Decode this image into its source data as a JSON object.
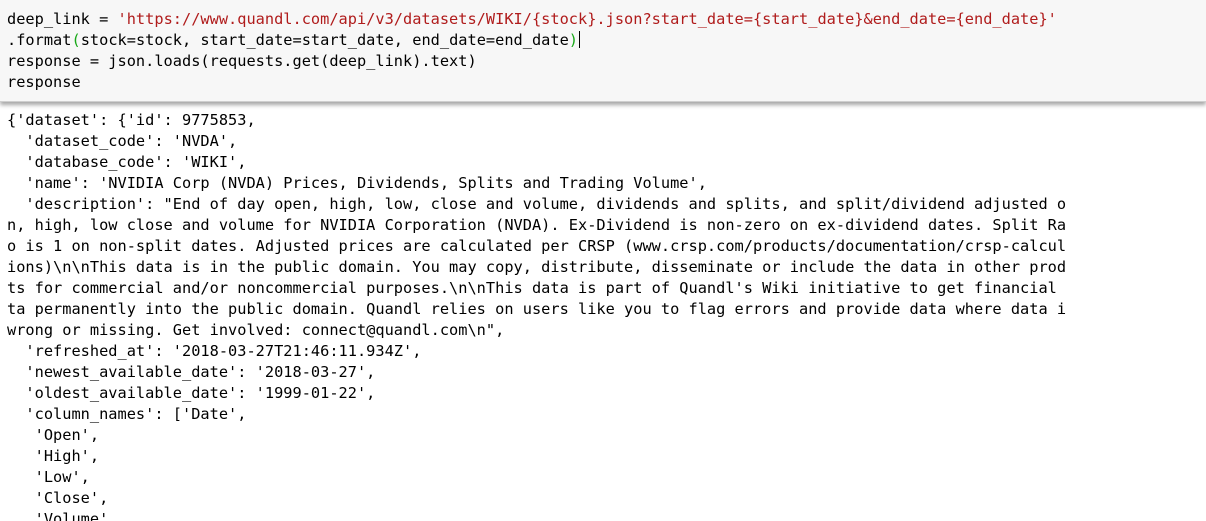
{
  "input_cell": {
    "line1": {
      "var": "deep_link = ",
      "string": "'https://www.quandl.com/api/v3/datasets/WIKI/{stock}.json?start_date={start_date}&end_date={end_date}'"
    },
    "line2": {
      "method": ".format",
      "open_paren": "(",
      "args": "stock=stock, start_date=start_date, end_date=end_date",
      "close_paren": ")"
    },
    "line3": "response = json.loads(requests.get(deep_link).text)",
    "line4": "response"
  },
  "output_lines": [
    "{'dataset': {'id': 9775853,",
    "  'dataset_code': 'NVDA',",
    "  'database_code': 'WIKI',",
    "  'name': 'NVIDIA Corp (NVDA) Prices, Dividends, Splits and Trading Volume',",
    "  'description': \"End of day open, high, low, close and volume, dividends and splits, and split/dividend adjusted o",
    "n, high, low close and volume for NVIDIA Corporation (NVDA). Ex-Dividend is non-zero on ex-dividend dates. Split Ra",
    "o is 1 on non-split dates. Adjusted prices are calculated per CRSP (www.crsp.com/products/documentation/crsp-calcul",
    "ions)\\n\\nThis data is in the public domain. You may copy, distribute, disseminate or include the data in other prod",
    "ts for commercial and/or noncommercial purposes.\\n\\nThis data is part of Quandl's Wiki initiative to get financial",
    "ta permanently into the public domain. Quandl relies on users like you to flag errors and provide data where data i",
    "wrong or missing. Get involved: connect@quandl.com\\n\",",
    "  'refreshed_at': '2018-03-27T21:46:11.934Z',",
    "  'newest_available_date': '2018-03-27',",
    "  'oldest_available_date': '1999-01-22',",
    "  'column_names': ['Date',",
    "   'Open',",
    "   'High',",
    "   'Low',",
    "   'Close',",
    "   'Volume',"
  ]
}
